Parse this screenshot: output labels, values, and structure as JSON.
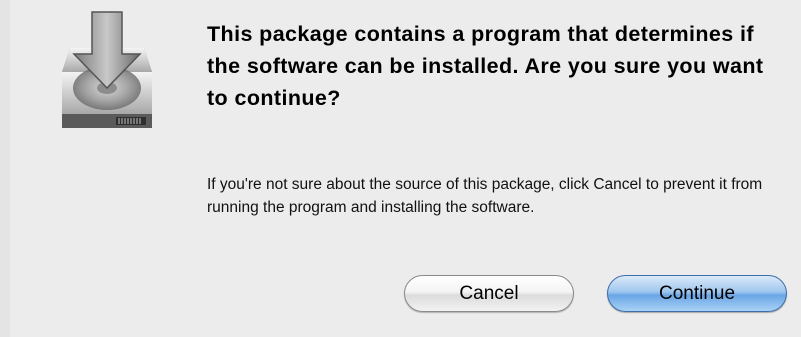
{
  "dialog": {
    "message_title": "This package contains a program that determines if the software can be installed.  Are you sure you want to continue?",
    "message_body": "If you're not sure about the source of this package, click Cancel to prevent it from running the program and installing the software.",
    "icon": "installer-disk-download-icon"
  },
  "buttons": {
    "cancel_label": "Cancel",
    "continue_label": "Continue"
  },
  "colors": {
    "default_button": "#7fb3ea",
    "sheet_background": "#ececec"
  }
}
